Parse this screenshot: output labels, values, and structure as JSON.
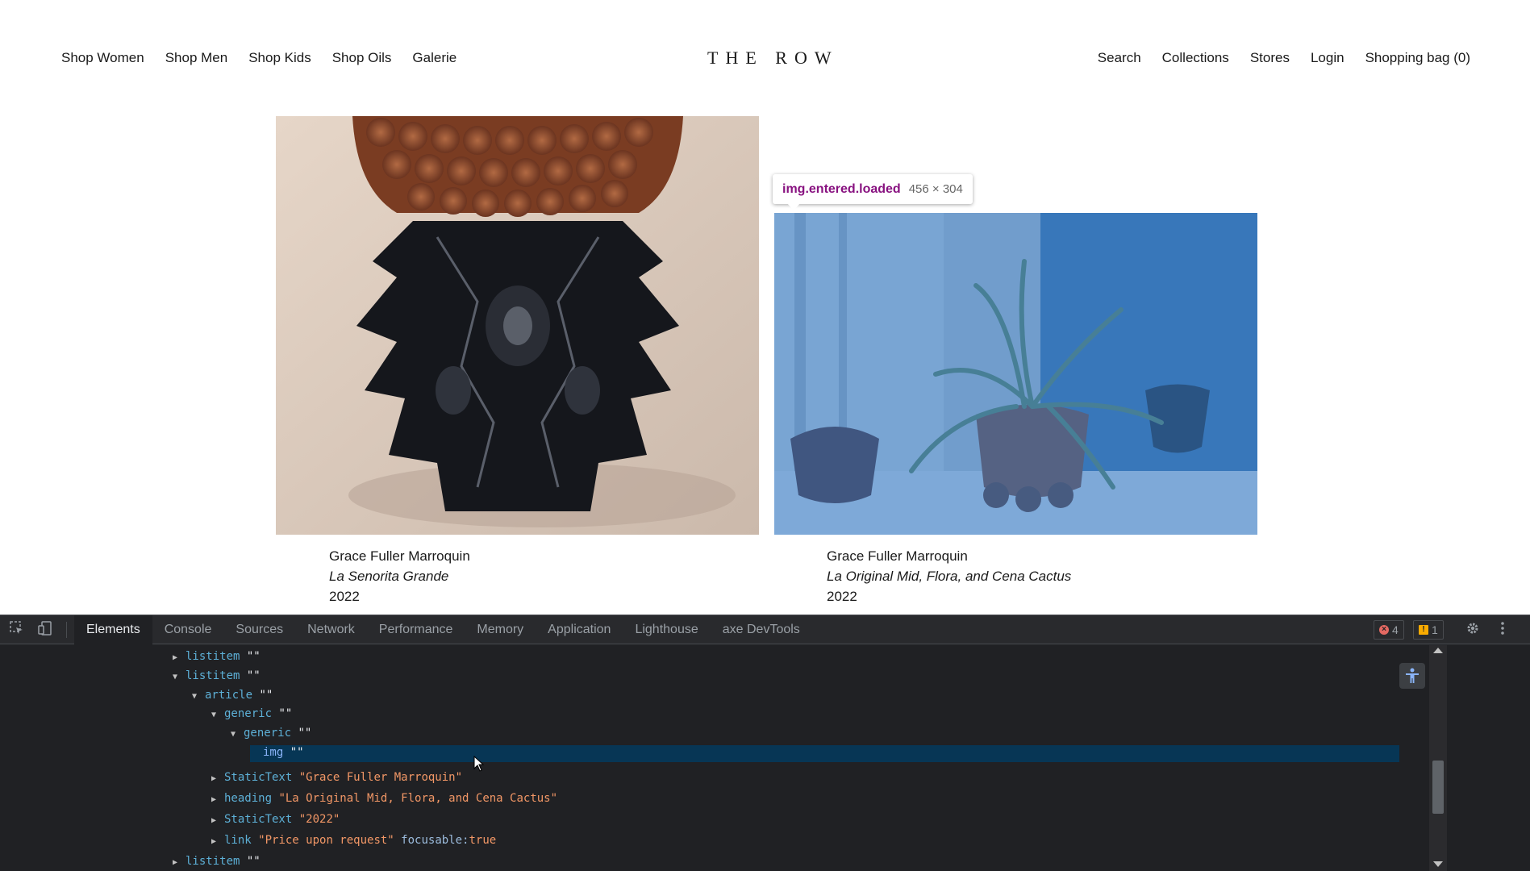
{
  "site": {
    "nav_left": [
      "Shop Women",
      "Shop Men",
      "Shop Kids",
      "Shop Oils",
      "Galerie"
    ],
    "logo": "THE ROW",
    "nav_right": [
      "Search",
      "Collections",
      "Stores",
      "Login",
      "Shopping bag (0)"
    ]
  },
  "gallery": {
    "items": [
      {
        "artist": "Grace Fuller Marroquin",
        "title": "La Senorita Grande",
        "year": "2022"
      },
      {
        "artist": "Grace Fuller Marroquin",
        "title": "La Original Mid, Flora, and Cena Cactus",
        "year": "2022"
      }
    ]
  },
  "inspect_tooltip": {
    "selector": "img.entered.loaded",
    "dimensions": "456 × 304"
  },
  "devtools": {
    "tabs": [
      "Elements",
      "Console",
      "Sources",
      "Network",
      "Performance",
      "Memory",
      "Application",
      "Lighthouse",
      "axe DevTools"
    ],
    "active_tab": "Elements",
    "error_count": "4",
    "warning_count": "1",
    "tree": [
      {
        "role": "listitem",
        "name": "\"\"",
        "expanded": false
      },
      {
        "role": "listitem",
        "name": "\"\"",
        "expanded": true
      },
      {
        "role": "article",
        "name": "\"\"",
        "expanded": true
      },
      {
        "role": "generic",
        "name": "\"\"",
        "expanded": true
      },
      {
        "role": "generic",
        "name": "\"\"",
        "expanded": true
      },
      {
        "role": "img",
        "name": "\"\"",
        "selected": true
      },
      {
        "role": "StaticText",
        "name": "\"Grace Fuller Marroquin\"",
        "expanded": false
      },
      {
        "role": "heading",
        "name": "\"La Original Mid, Flora, and Cena Cactus\"",
        "expanded": false
      },
      {
        "role": "StaticText",
        "name": "\"2022\"",
        "expanded": false
      },
      {
        "role": "link",
        "name": "\"Price upon request\"",
        "prop": "focusable:",
        "prop_value": "true",
        "expanded": false
      },
      {
        "role": "listitem",
        "name": "\"\"",
        "expanded": false
      }
    ]
  },
  "colors": {
    "highlight": "#2976c9",
    "devtools_bg": "#202124",
    "selection": "#073655"
  }
}
